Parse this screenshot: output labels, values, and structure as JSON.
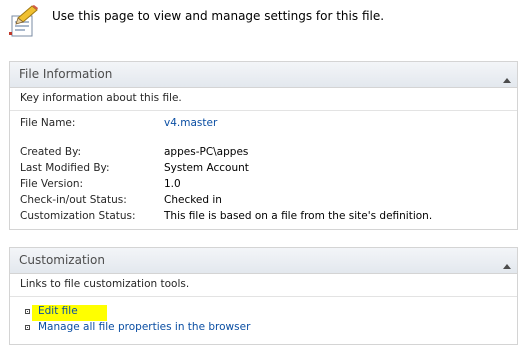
{
  "intro": {
    "icon": "document-pencil-icon",
    "text": "Use this page to view and manage settings for this file."
  },
  "file_information": {
    "title": "File Information",
    "description": "Key information about this file.",
    "file_name_label": "File Name:",
    "file_name_value": "v4.master",
    "fields": [
      {
        "label": "Created By:",
        "value": "appes-PC\\appes"
      },
      {
        "label": "Last Modified By:",
        "value": "System Account"
      },
      {
        "label": "File Version:",
        "value": "1.0"
      },
      {
        "label": "Check-in/out Status:",
        "value": "Checked in"
      },
      {
        "label": "Customization Status:",
        "value": "This file is based on a file from the site's definition."
      }
    ]
  },
  "customization": {
    "title": "Customization",
    "description": "Links to file customization tools.",
    "links": [
      {
        "label": "Edit file",
        "highlighted": true
      },
      {
        "label": "Manage all file properties in the browser",
        "highlighted": false
      }
    ]
  },
  "colors": {
    "link": "#0a4ea3",
    "highlight": "#ffff00",
    "panel_border": "#d4d4d4",
    "header_text": "#4c4c4c"
  }
}
